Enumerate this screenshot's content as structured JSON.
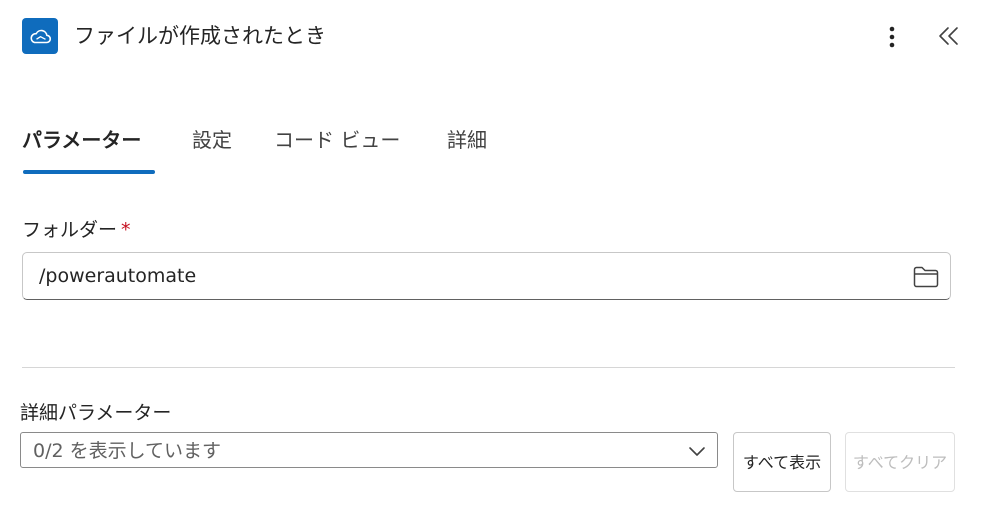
{
  "header": {
    "title": "ファイルが作成されたとき",
    "app_icon": "onedrive-cloud-icon",
    "more_icon": "more-vertical-icon",
    "collapse_icon": "double-chevron-left-icon",
    "brand_color": "#0f6cbd"
  },
  "tabs": [
    {
      "label": "パラメーター",
      "active": true
    },
    {
      "label": "設定",
      "active": false
    },
    {
      "label": "コード ビュー",
      "active": false
    },
    {
      "label": "詳細",
      "active": false
    }
  ],
  "folder": {
    "label": "フォルダー",
    "required_mark": "*",
    "value": "/powerautomate",
    "icon": "folder-icon"
  },
  "advanced": {
    "label": "詳細パラメーター",
    "select_value": "0/2 を表示しています",
    "show_all_label": "すべて表示",
    "clear_all_label": "すべてクリア"
  }
}
